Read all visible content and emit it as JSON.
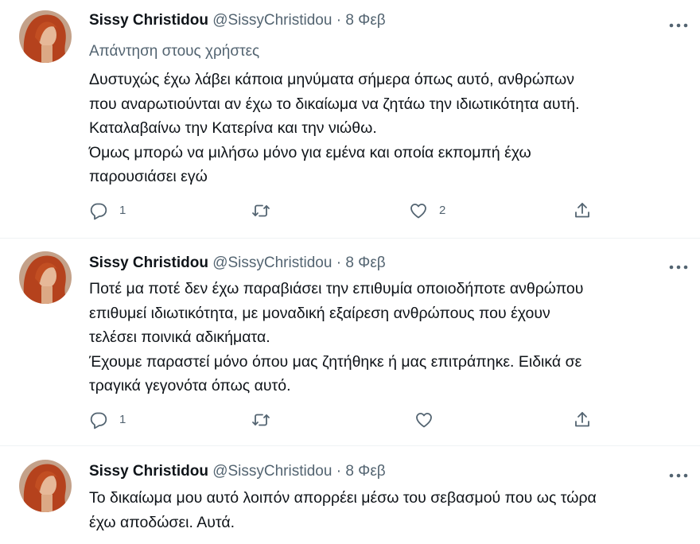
{
  "tweets": [
    {
      "author_name": "Sissy Christidou",
      "handle": "@SissyChristidou",
      "separator": "·",
      "date": "8 Φεβ",
      "reply_context": "Απάντηση στους χρήστες",
      "text": "Δυστυχώς έχω λάβει κάποια μηνύματα σήμερα όπως αυτό, ανθρώπων\nπου αναρωτιούνται αν έχω το δικαίωμα να ζητάω την ιδιωτικότητα αυτή.\nΚαταλαβαίνω την Κατερίνα και την νιώθω.\nΌμως μπορώ να μιλήσω μόνο για εμένα και οποία εκπομπή έχω\nπαρουσιάσει εγώ",
      "reply_count": "1",
      "retweet_count": "",
      "like_count": "2"
    },
    {
      "author_name": "Sissy Christidou",
      "handle": "@SissyChristidou",
      "separator": "·",
      "date": "8 Φεβ",
      "text": "Ποτέ μα ποτέ δεν έχω παραβιάσει την επιθυμία οποιοδήποτε ανθρώπου\nεπιθυμεί ιδιωτικότητα, με μοναδική εξαίρεση ανθρώπους που έχουν\nτελέσει ποινικά αδικήματα.\nΈχουμε παραστεί μόνο όπου μας ζητήθηκε ή μας επιτράπηκε. Ειδικά σε\nτραγικά γεγονότα όπως αυτό.",
      "reply_count": "1",
      "retweet_count": "",
      "like_count": ""
    },
    {
      "author_name": "Sissy Christidou",
      "handle": "@SissyChristidou",
      "separator": "·",
      "date": "8 Φεβ",
      "text": "Το δικαίωμα μου αυτό λοιπόν απορρέει μέσω του σεβασμού που ως τώρα\nέχω αποδώσει. Αυτά."
    }
  ],
  "icons": {
    "more": "more-dots-icon",
    "reply": "speech-bubble-icon",
    "retweet": "retweet-arrows-icon",
    "like": "heart-icon",
    "share": "share-upload-icon"
  },
  "colors": {
    "text": "#0f1419",
    "secondary": "#536471",
    "divider": "#eff3f4",
    "avatar_hair": "#b5421d"
  }
}
